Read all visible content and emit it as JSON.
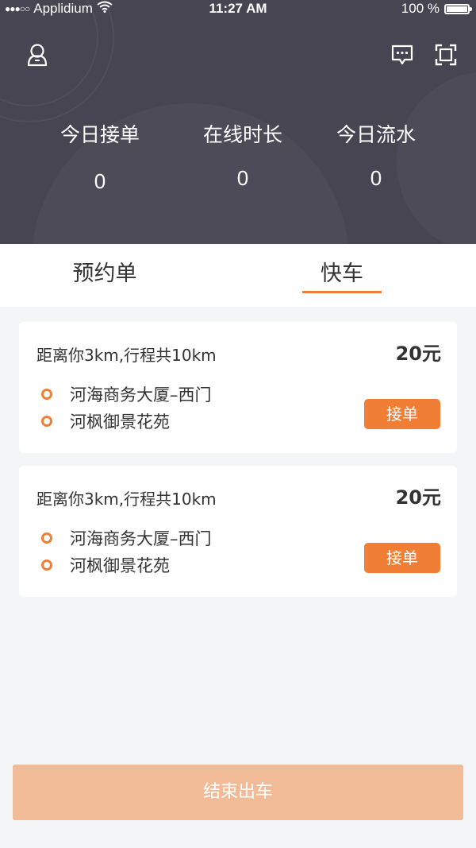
{
  "status_bar": {
    "carrier": "Applidium",
    "time": "11:27 AM",
    "battery": "100 %"
  },
  "header": {
    "profile_icon": "user-icon",
    "message_icon": "chat-icon",
    "scan_icon": "scan-icon",
    "stats": [
      {
        "label": "今日接单",
        "value": "0"
      },
      {
        "label": "在线时长",
        "value": "0"
      },
      {
        "label": "今日流水",
        "value": "0"
      }
    ]
  },
  "tabs": [
    {
      "label": "预约单",
      "active": false
    },
    {
      "label": "快车",
      "active": true
    }
  ],
  "orders": [
    {
      "distance": "距离你3km,行程共10km",
      "price": "20元",
      "from": "河海商务大厦–西门",
      "to": "河枫御景花苑",
      "accept_label": "接单"
    },
    {
      "distance": "距离你3km,行程共10km",
      "price": "20元",
      "from": "河海商务大厦–西门",
      "to": "河枫御景花苑",
      "accept_label": "接单"
    }
  ],
  "end_button": {
    "label": "结束出车"
  },
  "colors": {
    "header_bg": "#474552",
    "accent": "#f07f35",
    "end_button_bg": "#f1bb98",
    "page_bg": "#f4f5f7"
  }
}
